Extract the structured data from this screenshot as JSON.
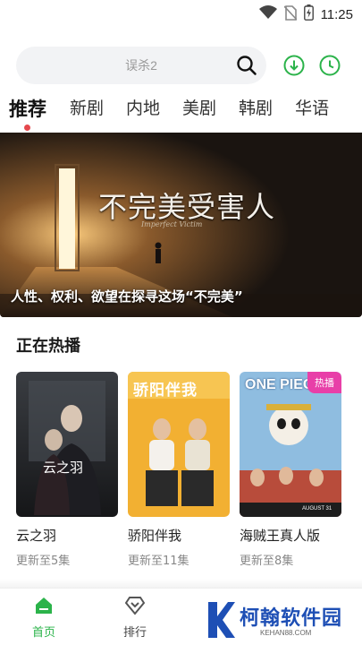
{
  "status_bar": {
    "time": "11:25",
    "icons": [
      "wifi-icon",
      "no-sim-icon",
      "battery-charging-icon"
    ]
  },
  "search": {
    "placeholder": "误杀2",
    "icon": "search-icon"
  },
  "header_buttons": [
    {
      "icon": "download-icon",
      "color": "#2bb34a"
    },
    {
      "icon": "history-clock-icon",
      "color": "#2bb34a"
    }
  ],
  "tabs": [
    {
      "label": "推荐",
      "active": true
    },
    {
      "label": "新剧",
      "active": false
    },
    {
      "label": "内地",
      "active": false
    },
    {
      "label": "美剧",
      "active": false
    },
    {
      "label": "韩剧",
      "active": false
    },
    {
      "label": "华语",
      "active": false
    }
  ],
  "banner": {
    "title": "不完美受害人",
    "subtitle": "Imperfect Victim",
    "caption": "人性、权利、欲望在探寻这场“不完美”"
  },
  "section": {
    "title": "正在热播"
  },
  "cards": [
    {
      "poster_title": "云之羽",
      "name": "云之羽",
      "episodes": "更新至5集",
      "badge": ""
    },
    {
      "poster_title": "骄阳伴我",
      "name": "骄阳伴我",
      "episodes": "更新至11集",
      "badge": ""
    },
    {
      "poster_title": "ONE PIECE",
      "name": "海贼王真人版",
      "episodes": "更新至8集",
      "badge": "热播",
      "poster_date": "AUGUST 31"
    }
  ],
  "bottom_nav": [
    {
      "label": "首页",
      "icon": "home-icon",
      "active": true
    },
    {
      "label": "排行",
      "icon": "diamond-rank-icon",
      "active": false
    },
    {
      "label": "",
      "icon": "folder-icon",
      "active": false
    },
    {
      "label": "",
      "icon": "profile-icon",
      "active": false
    }
  ],
  "watermark": {
    "brand": "柯翰软件园",
    "site": "KEHAN88.COM"
  },
  "colors": {
    "accent": "#2bb34a",
    "badge": "#e83fa8",
    "tab_dot": "#e5484d",
    "watermark": "#1e4fb5"
  }
}
